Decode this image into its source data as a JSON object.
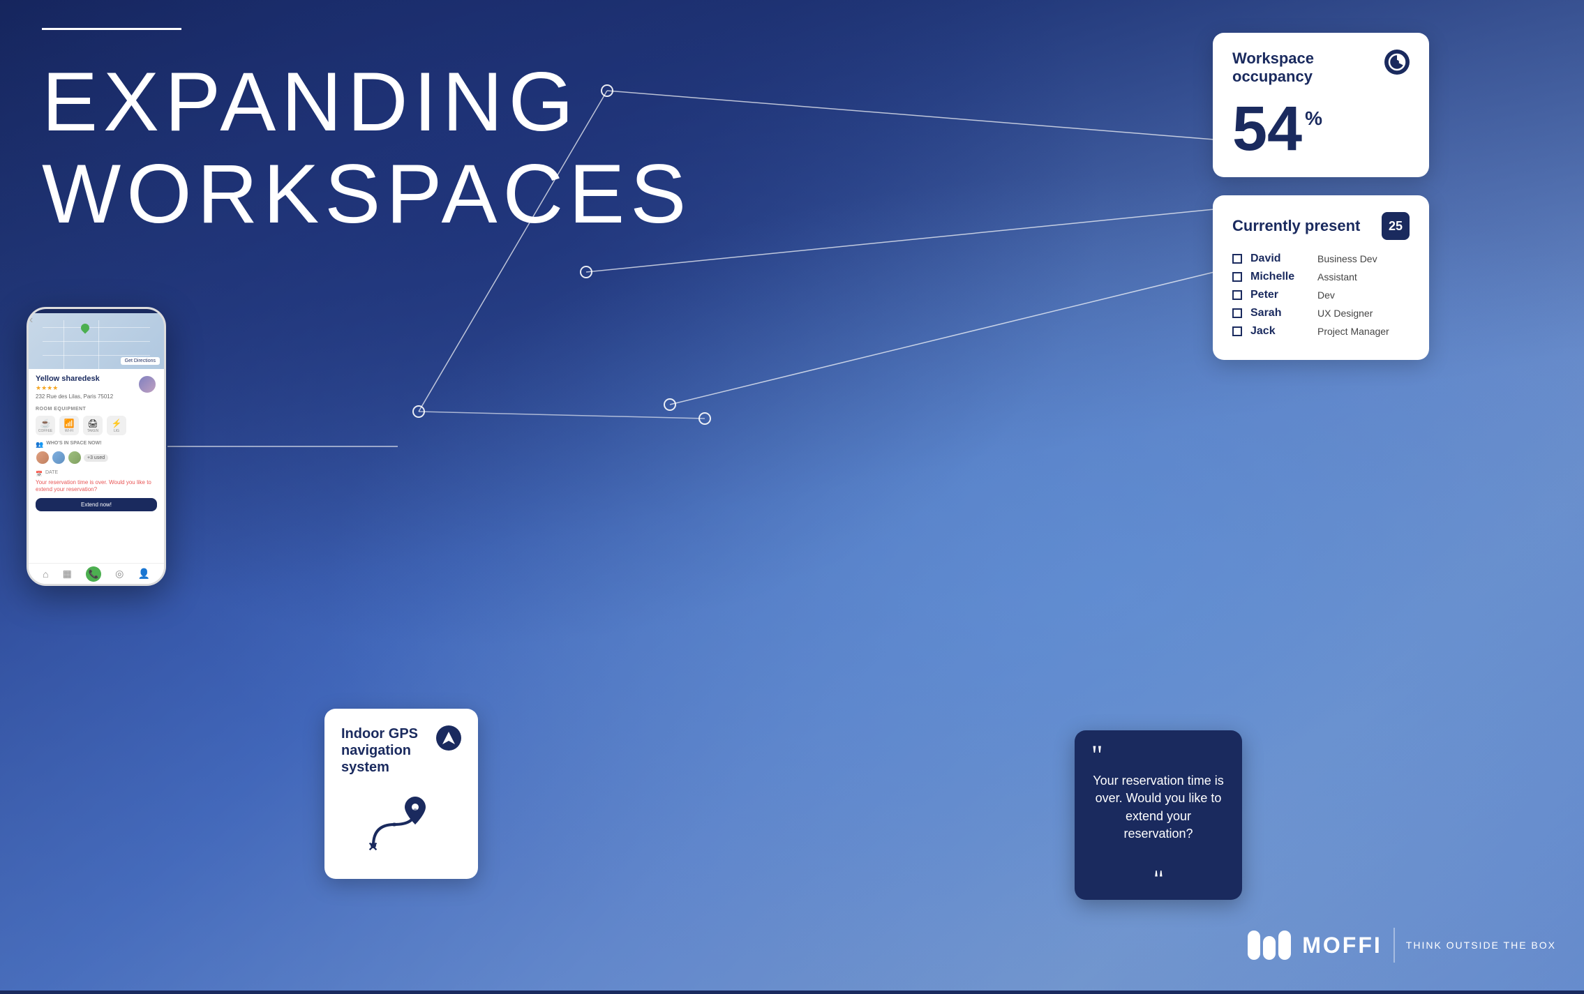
{
  "background": {
    "color_dark": "#1a2a5e",
    "color_mid": "#3a5db8",
    "color_light": "#6a8cd4"
  },
  "headline": {
    "line1": "EXPANDING",
    "line2": "WORKSPACES"
  },
  "card_occupancy": {
    "title": "Workspace occupancy",
    "value": "54",
    "unit": "%",
    "icon": "pie-chart-icon"
  },
  "card_present": {
    "title": "Currently present",
    "count": "25",
    "people": [
      {
        "name": "David",
        "role": "Business Dev"
      },
      {
        "name": "Michelle",
        "role": "Assistant"
      },
      {
        "name": "Peter",
        "role": "Dev"
      },
      {
        "name": "Sarah",
        "role": "UX Designer"
      },
      {
        "name": "Jack",
        "role": "Project Manager"
      }
    ]
  },
  "card_gps": {
    "title": "Indoor GPS navigation system",
    "icon": "navigation-icon"
  },
  "card_reservation": {
    "text": "Your reservation time is over. Would you like to extend your reservation?"
  },
  "phone": {
    "venue_name": "Yellow sharedesk",
    "stars": "★★★★",
    "address": "232 Rue des Lilas, Paris 75012",
    "section_equipment": "ROOM EQUIPMENT",
    "amenities": [
      "☕",
      "📶",
      "🖨",
      "⚡"
    ],
    "amenity_labels": [
      "COFFEE",
      "WI-FI",
      "TAKEN",
      "LIG"
    ],
    "section_whoin": "WHO'S IN SPACE NOW!",
    "section_date": "DATE",
    "reservation_text": "Your reservation time is over. Would you like to extend your reservation?",
    "extend_label": "Extend now!",
    "avatar_count": "+3 used"
  },
  "logo": {
    "brand": "MOFFI",
    "tagline": "THINK OUTSIDE THE BOX"
  }
}
